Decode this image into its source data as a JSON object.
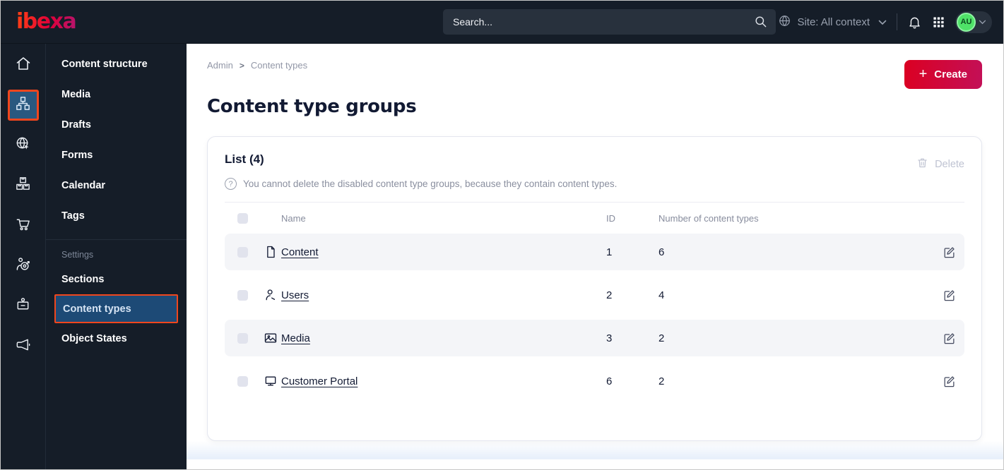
{
  "topbar": {
    "logo_text": "ibexa",
    "search_placeholder": "Search...",
    "site_context_label": "Site: All context",
    "avatar_initials": "AU"
  },
  "icon_rail": {
    "items": [
      {
        "icon": "home-icon",
        "active": false
      },
      {
        "icon": "content-structure-icon",
        "active": true
      },
      {
        "icon": "site-globe-icon",
        "active": false
      },
      {
        "icon": "product-catalog-icon",
        "active": false
      },
      {
        "icon": "commerce-cart-icon",
        "active": false
      },
      {
        "icon": "personalization-target-icon",
        "active": false
      },
      {
        "icon": "admin-badge-icon",
        "active": false
      },
      {
        "icon": "campaign-megaphone-icon",
        "active": false
      }
    ]
  },
  "sidebar": {
    "items": [
      {
        "label": "Content structure"
      },
      {
        "label": "Media"
      },
      {
        "label": "Drafts"
      },
      {
        "label": "Forms"
      },
      {
        "label": "Calendar"
      },
      {
        "label": "Tags"
      }
    ],
    "section_label": "Settings",
    "settings_items": [
      {
        "label": "Sections",
        "active": false
      },
      {
        "label": "Content types",
        "active": true
      },
      {
        "label": "Object States",
        "active": false
      }
    ]
  },
  "main": {
    "breadcrumb": [
      "Admin",
      "Content types"
    ],
    "breadcrumb_separator": ">",
    "create_plus": "+",
    "create_label": "Create",
    "page_title": "Content type groups",
    "card": {
      "list_title": "List (4)",
      "delete_label": "Delete",
      "info_icon": "?",
      "info_text": "You cannot delete the disabled content type groups, because they contain content types.",
      "table": {
        "columns": [
          "Name",
          "ID",
          "Number of content types"
        ],
        "rows": [
          {
            "name": "Content",
            "icon": "file",
            "id": "1",
            "count": "6"
          },
          {
            "name": "Users",
            "icon": "user",
            "id": "2",
            "count": "4"
          },
          {
            "name": "Media",
            "icon": "image",
            "id": "3",
            "count": "2"
          },
          {
            "name": "Customer Portal",
            "icon": "monitor",
            "id": "6",
            "count": "2"
          }
        ]
      }
    }
  },
  "colors": {
    "topbar_bg": "#151d28",
    "accent_orange": "#f0461d",
    "active_blue": "#1d4a76",
    "brand_red": "#db0022",
    "brand_magenta": "#c31057",
    "avatar_green": "#4fe268",
    "row_stripe": "#f4f5f8"
  }
}
